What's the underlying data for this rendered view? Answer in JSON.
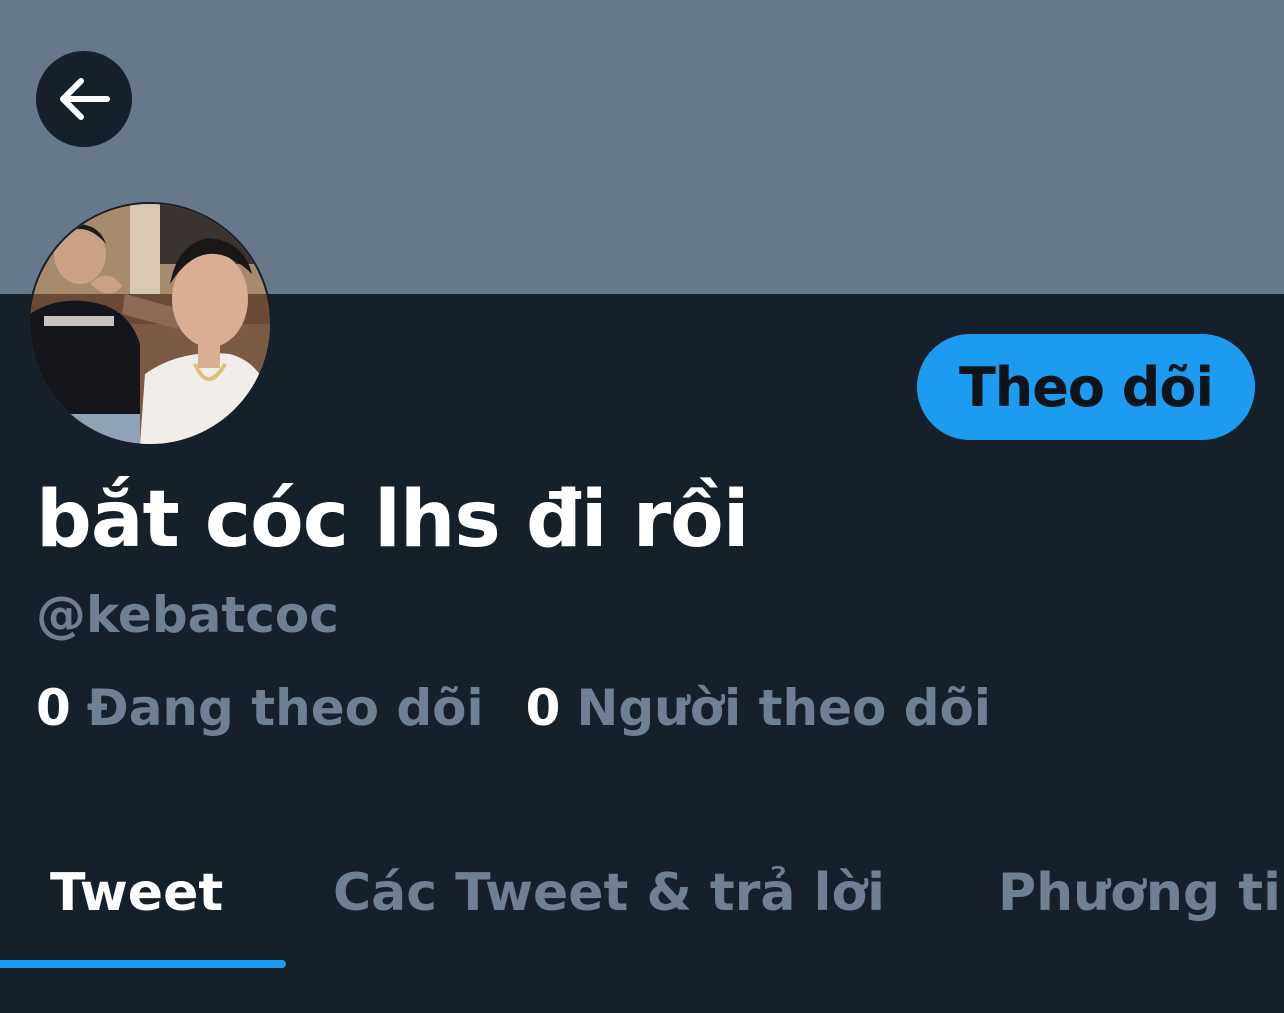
{
  "header": {
    "back_icon": "arrow-left-icon",
    "banner_color": "#66788a"
  },
  "profile": {
    "display_name": "bắt cóc lhs đi rồi",
    "handle": "@kebatcoc",
    "avatar_icon": "profile-photo",
    "follow_label": "Theo dõi"
  },
  "stats": {
    "following_count": "0",
    "following_label": "Đang theo dõi",
    "followers_count": "0",
    "followers_label": "Người theo dõi"
  },
  "tabs": [
    {
      "label": "Tweet",
      "active": true
    },
    {
      "label": "Các Tweet & trả lời",
      "active": false
    },
    {
      "label": "Phương ti",
      "active": false
    }
  ],
  "colors": {
    "background": "#15202b",
    "accent": "#1d9bf0",
    "muted_text": "#6e8091",
    "primary_text": "#ffffff"
  }
}
